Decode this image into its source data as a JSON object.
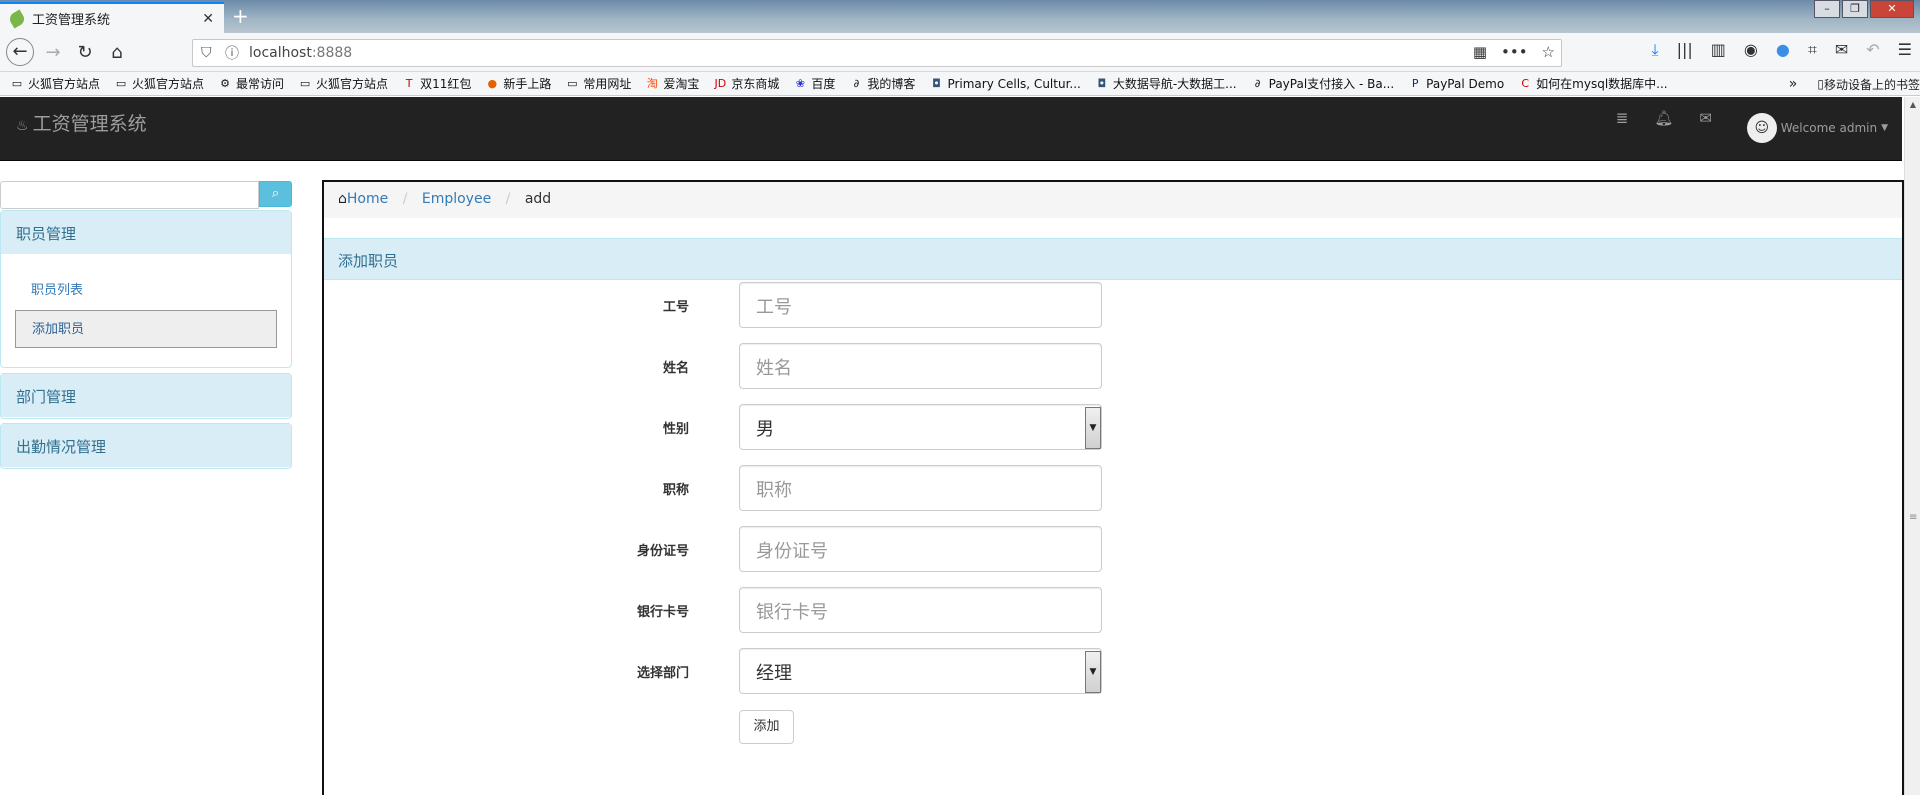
{
  "browser": {
    "tab_title": "工资管理系统",
    "tab_close": "✕",
    "new_tab": "+",
    "url_host": "localhost",
    "url_port": ":8888",
    "bookmarks": [
      {
        "icon": "folder-icon",
        "label": "火狐官方站点"
      },
      {
        "icon": "folder-icon",
        "label": "火狐官方站点"
      },
      {
        "icon": "gear-icon",
        "label": "最常访问"
      },
      {
        "icon": "folder-icon",
        "label": "火狐官方站点"
      },
      {
        "icon": "tmall-icon",
        "label": "双11红包"
      },
      {
        "icon": "firefox-icon",
        "label": "新手上路"
      },
      {
        "icon": "folder-icon",
        "label": "常用网址"
      },
      {
        "icon": "taobao-icon",
        "label": "爱淘宝"
      },
      {
        "icon": "jd-icon",
        "label": "京东商城"
      },
      {
        "icon": "baidu-icon",
        "label": "百度"
      },
      {
        "icon": "blog-icon",
        "label": "我的博客"
      },
      {
        "icon": "web-icon",
        "label": "Primary Cells, Cultur..."
      },
      {
        "icon": "web-icon",
        "label": "大数据导航-大数据工..."
      },
      {
        "icon": "blog-icon",
        "label": "PayPal支付接入 - Ba..."
      },
      {
        "icon": "paypal-icon",
        "label": "PayPal Demo"
      },
      {
        "icon": "csdn-icon",
        "label": "如何在mysql数据库中..."
      }
    ],
    "mobile_bookmarks": "移动设备上的书签"
  },
  "app": {
    "brand": "工资管理系统",
    "welcome": "Welcome admin"
  },
  "sidebar": {
    "panels": [
      {
        "title": "职员管理",
        "items": [
          "职员列表",
          "添加职员"
        ]
      },
      {
        "title": "部门管理"
      },
      {
        "title": "出勤情况管理"
      }
    ]
  },
  "breadcrumb": {
    "home": "Home",
    "employee": "Employee",
    "current": "add",
    "sep": "/"
  },
  "form": {
    "title": "添加职员",
    "fields": [
      {
        "label": "工号",
        "placeholder": "工号"
      },
      {
        "label": "姓名",
        "placeholder": "姓名"
      },
      {
        "label": "性别",
        "value": "男"
      },
      {
        "label": "职称",
        "placeholder": "职称"
      },
      {
        "label": "身份证号",
        "placeholder": "身份证号"
      },
      {
        "label": "银行卡号",
        "placeholder": "银行卡号"
      },
      {
        "label": "选择部门",
        "value": "经理"
      }
    ],
    "submit": "添加"
  },
  "colors": {
    "accent": "#0a84ff",
    "panel_bg": "#d9edf7",
    "panel_text": "#31708f",
    "link": "#337ab7",
    "header_bg": "#222222"
  }
}
